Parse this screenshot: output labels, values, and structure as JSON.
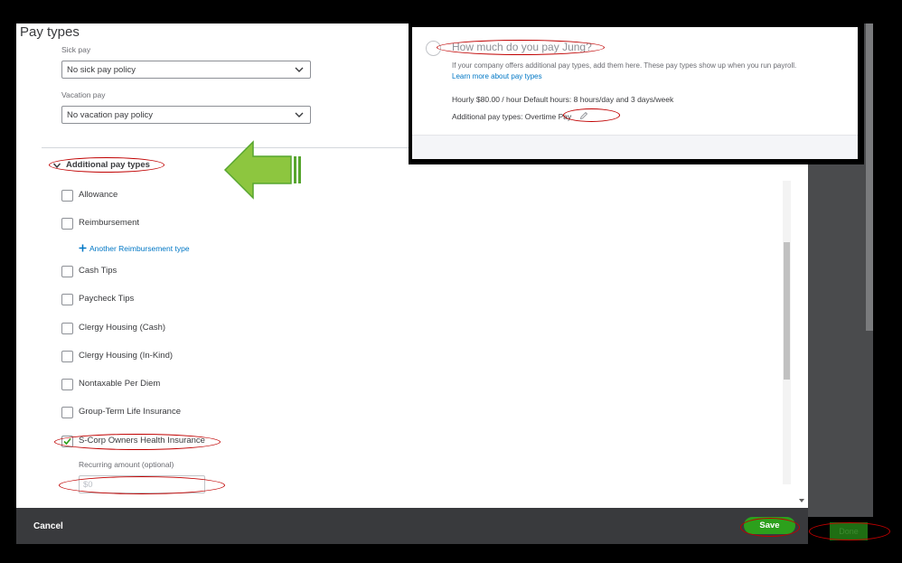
{
  "dialog": {
    "title": "Pay types",
    "sick_pay": {
      "label": "Sick pay",
      "value": "No sick pay policy"
    },
    "vacation_pay": {
      "label": "Vacation pay",
      "value": "No vacation pay policy"
    },
    "additional_section": "Additional pay types",
    "pay_types": [
      {
        "label": "Allowance",
        "checked": false
      },
      {
        "label": "Reimbursement",
        "checked": false
      },
      {
        "label": "Cash Tips",
        "checked": false
      },
      {
        "label": "Paycheck Tips",
        "checked": false
      },
      {
        "label": "Clergy Housing (Cash)",
        "checked": false
      },
      {
        "label": "Clergy Housing (In-Kind)",
        "checked": false
      },
      {
        "label": "Nontaxable Per Diem",
        "checked": false
      },
      {
        "label": "Group-Term Life Insurance",
        "checked": false
      },
      {
        "label": "S-Corp Owners Health Insurance",
        "checked": true
      }
    ],
    "another_reimbursement_link": "Another Reimbursement type",
    "recurring_amount": {
      "label": "Recurring amount (optional)",
      "placeholder": "$0"
    }
  },
  "footer": {
    "cancel_label": "Cancel",
    "save_label": "Save",
    "done_label": "Done"
  },
  "inset": {
    "heading": "How much do you pay Jung?",
    "description": "If your company offers additional pay types, add them here. These pay types show up when you run payroll.",
    "learn_more": "Learn more about pay types",
    "rate_line": "Hourly $80.00 / hour    Default hours: 8 hours/day and 3 days/week",
    "additional_line": "Additional pay types: Overtime Pay"
  },
  "colors": {
    "save_green": "#2ca01c",
    "link_blue": "#0077c5",
    "annotation_red": "#c00000",
    "arrow_green": "#8dc63f"
  },
  "icons": [
    "chevron-down-icon",
    "checkmark-icon",
    "plus-icon",
    "pencil-icon",
    "arrow-left-icon"
  ]
}
